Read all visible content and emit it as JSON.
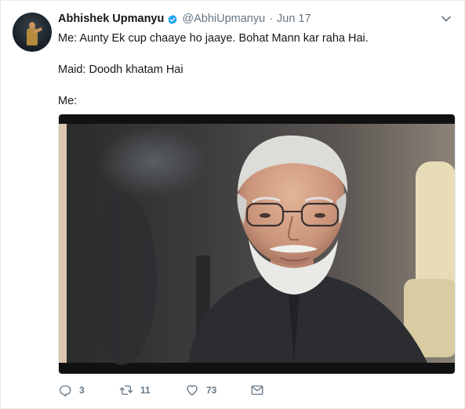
{
  "tweet": {
    "author": {
      "name": "Abhishek Upmanyu",
      "handle": "@AbhiUpmanyu",
      "verified": true,
      "separator": "·",
      "date": "Jun 17"
    },
    "lines": [
      "Me: Aunty Ek cup chaaye ho jaaye. Bohat Mann kar raha Hai.",
      "Maid: Doodh khatam Hai",
      "Me:"
    ],
    "media": {
      "description_icon": "photo-of-man-with-glasses"
    },
    "actions": {
      "replies": "3",
      "retweets": "11",
      "likes": "73"
    }
  },
  "colors": {
    "verified_blue": "#1da1f2",
    "secondary_text": "#657786",
    "border": "#e6ecf0"
  },
  "icons": {
    "reply": "reply-icon",
    "retweet": "retweet-icon",
    "like": "heart-icon",
    "message": "envelope-icon",
    "menu": "chevron-down-icon",
    "verified": "verified-badge-icon"
  }
}
